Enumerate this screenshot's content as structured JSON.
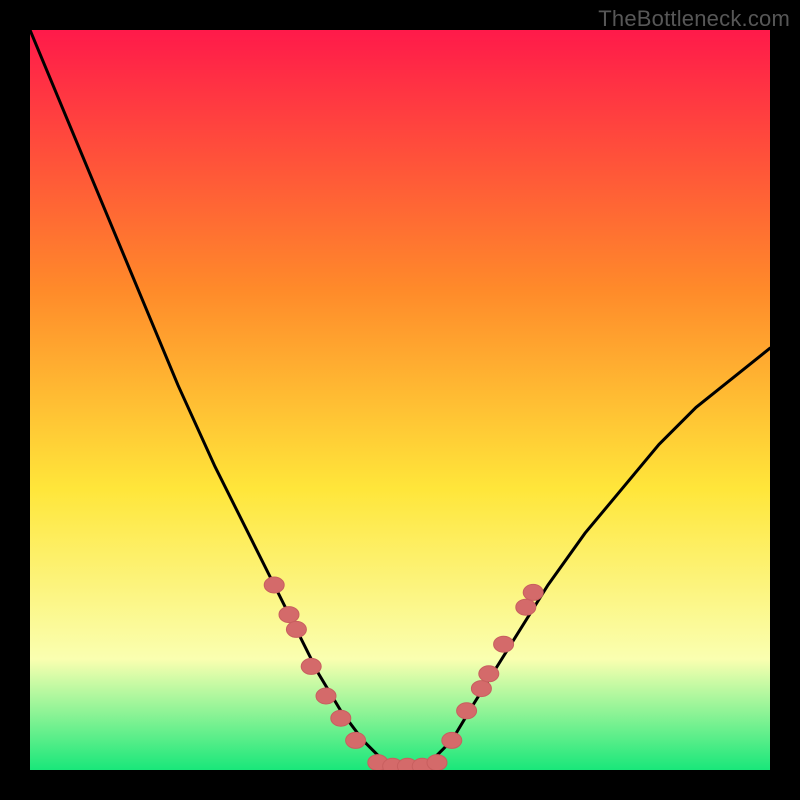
{
  "watermark": "TheBottleneck.com",
  "colors": {
    "frame": "#000000",
    "gradient_top": "#ff1a4a",
    "gradient_mid1": "#ff8a2a",
    "gradient_mid2": "#ffe63a",
    "gradient_mid3": "#faffb0",
    "gradient_bottom": "#19e77a",
    "curve": "#000000",
    "marker_fill": "#d46a6a",
    "marker_stroke": "#c85f5f"
  },
  "chart_data": {
    "type": "line",
    "title": "",
    "xlabel": "",
    "ylabel": "",
    "xlim": [
      0,
      100
    ],
    "ylim": [
      0,
      100
    ],
    "series": [
      {
        "name": "bottleneck-curve",
        "x": [
          0,
          5,
          10,
          15,
          20,
          25,
          30,
          33,
          36,
          39,
          42,
          45,
          48,
          51,
          54,
          57,
          60,
          65,
          70,
          75,
          80,
          85,
          90,
          95,
          100
        ],
        "y": [
          100,
          88,
          76,
          64,
          52,
          41,
          31,
          25,
          19,
          13,
          8,
          4,
          1,
          0,
          1,
          4,
          9,
          17,
          25,
          32,
          38,
          44,
          49,
          53,
          57
        ]
      }
    ],
    "markers": [
      {
        "x": 33,
        "y": 25
      },
      {
        "x": 35,
        "y": 21
      },
      {
        "x": 36,
        "y": 19
      },
      {
        "x": 38,
        "y": 14
      },
      {
        "x": 40,
        "y": 10
      },
      {
        "x": 42,
        "y": 7
      },
      {
        "x": 44,
        "y": 4
      },
      {
        "x": 47,
        "y": 1
      },
      {
        "x": 49,
        "y": 0.5
      },
      {
        "x": 51,
        "y": 0.5
      },
      {
        "x": 53,
        "y": 0.5
      },
      {
        "x": 55,
        "y": 1
      },
      {
        "x": 57,
        "y": 4
      },
      {
        "x": 59,
        "y": 8
      },
      {
        "x": 61,
        "y": 11
      },
      {
        "x": 62,
        "y": 13
      },
      {
        "x": 64,
        "y": 17
      },
      {
        "x": 67,
        "y": 22
      },
      {
        "x": 68,
        "y": 24
      }
    ],
    "gradient_stops": [
      {
        "offset": 0.0,
        "color": "#ff1a4a"
      },
      {
        "offset": 0.35,
        "color": "#ff8a2a"
      },
      {
        "offset": 0.62,
        "color": "#ffe63a"
      },
      {
        "offset": 0.85,
        "color": "#faffb0"
      },
      {
        "offset": 1.0,
        "color": "#19e77a"
      }
    ]
  }
}
